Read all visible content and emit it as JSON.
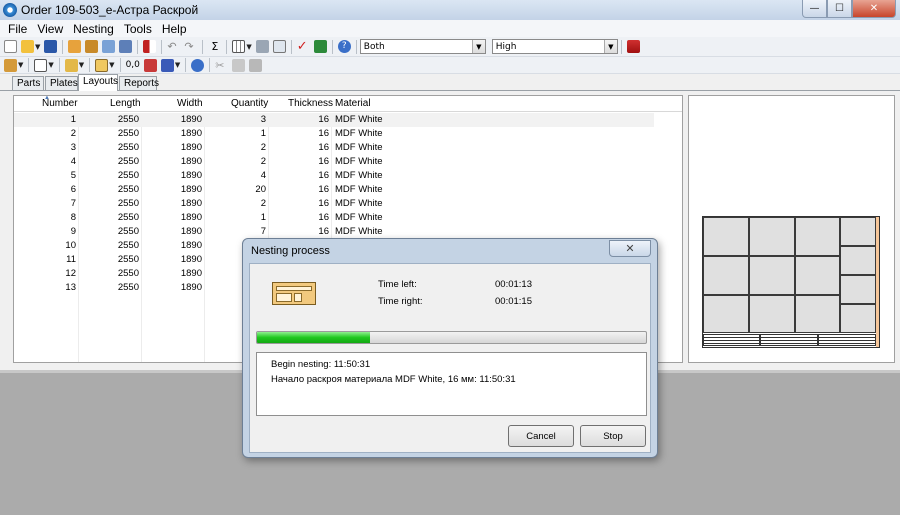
{
  "window": {
    "title": "Order 109-503_e-Астра Раскрой",
    "minimize": "—",
    "maximize": "☐",
    "close": "✕"
  },
  "menu": [
    "File",
    "View",
    "Nesting",
    "Tools",
    "Help"
  ],
  "toolbar": {
    "mode_select": "Both",
    "quality_select": "High",
    "icons": [
      "new-icon",
      "open-icon",
      "save-icon",
      "parts-icon",
      "plates-icon",
      "import-icon",
      "print-preview-icon",
      "run-icon",
      "undo-icon",
      "redo-icon",
      "sum-icon",
      "grid-icon",
      "print-icon",
      "preview-icon",
      "check-icon",
      "binoculars-icon",
      "help-icon",
      "settings-icon"
    ]
  },
  "toolbar2": {
    "decimal_label": "0,0",
    "icons": [
      "cabinet-icon",
      "list-icon",
      "edit-icon",
      "table-icon",
      "rotate-icon",
      "sort-icon",
      "info-icon",
      "cut-icon",
      "copy-icon",
      "paste-icon"
    ]
  },
  "tabs": [
    "Parts",
    "Plates",
    "Layouts",
    "Reports"
  ],
  "active_tab": "Layouts",
  "table": {
    "columns": [
      "Number",
      "Length",
      "Width",
      "Quantity",
      "Thickness",
      "Material"
    ],
    "rows": [
      [
        "1",
        "2550",
        "1890",
        "3",
        "16",
        "MDF White"
      ],
      [
        "2",
        "2550",
        "1890",
        "1",
        "16",
        "MDF White"
      ],
      [
        "3",
        "2550",
        "1890",
        "2",
        "16",
        "MDF White"
      ],
      [
        "4",
        "2550",
        "1890",
        "2",
        "16",
        "MDF White"
      ],
      [
        "5",
        "2550",
        "1890",
        "4",
        "16",
        "MDF White"
      ],
      [
        "6",
        "2550",
        "1890",
        "20",
        "16",
        "MDF White"
      ],
      [
        "7",
        "2550",
        "1890",
        "2",
        "16",
        "MDF White"
      ],
      [
        "8",
        "2550",
        "1890",
        "1",
        "16",
        "MDF White"
      ],
      [
        "9",
        "2550",
        "1890",
        "7",
        "16",
        "MDF White"
      ],
      [
        "10",
        "2550",
        "1890",
        "",
        "",
        ""
      ],
      [
        "11",
        "2550",
        "1890",
        "",
        "",
        ""
      ],
      [
        "12",
        "2550",
        "1890",
        "",
        "",
        ""
      ],
      [
        "13",
        "2550",
        "1890",
        "",
        "",
        ""
      ]
    ]
  },
  "dialog": {
    "title": "Nesting process",
    "close": "✕",
    "time_left_label": "Time left:",
    "time_left_value": "00:01:13",
    "time_right_label": "Time right:",
    "time_right_value": "00:01:15",
    "progress_fraction": 0.29,
    "log": [
      "Begin nesting: 11:50:31",
      "Начало раскроя материала MDF White, 16 мм: 11:50:31"
    ],
    "cancel": "Cancel",
    "stop": "Stop"
  },
  "colors": {
    "progress": "#1ec81e",
    "offcut": "#f7c79a",
    "piece": "#e0e0e0"
  }
}
